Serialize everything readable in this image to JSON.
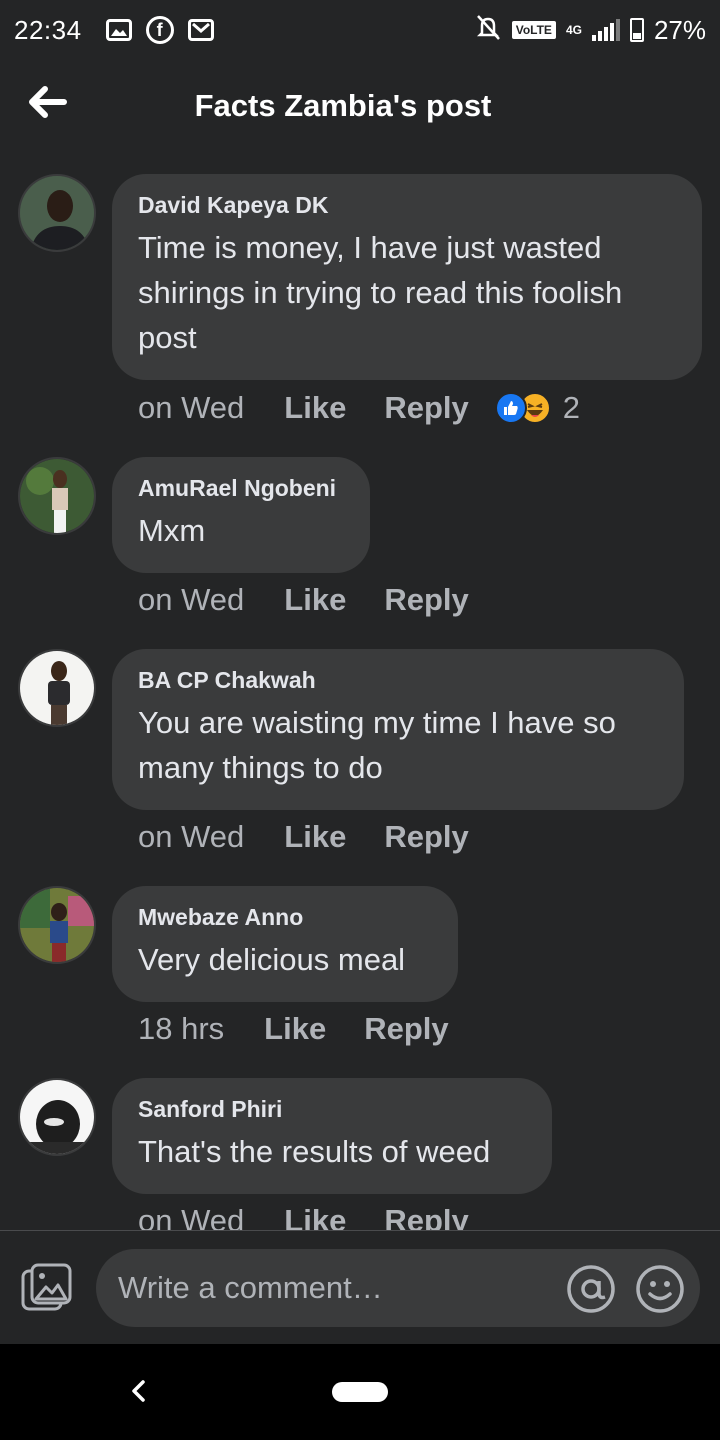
{
  "status_bar": {
    "time": "22:34",
    "volte": "VoLTE",
    "network": "4G",
    "battery": "27%",
    "icons_left": [
      "gallery-icon",
      "facebook-icon",
      "gmail-icon"
    ],
    "icons_right": [
      "mute-icon",
      "signal-icon",
      "battery-icon"
    ]
  },
  "header": {
    "title": "Facts Zambia's post"
  },
  "comments": [
    {
      "author": "David Kapeya DK",
      "lines": [
        "Time is money, I have just wasted",
        "shirings in trying to read this foolish",
        "post"
      ],
      "time": "on Wed",
      "like": "Like",
      "reply": "Reply",
      "reaction_count": "2"
    },
    {
      "author": "AmuRael Ngobeni",
      "lines": [
        "Mxm"
      ],
      "time": "on Wed",
      "like": "Like",
      "reply": "Reply"
    },
    {
      "author": "BA CP Chakwah",
      "lines": [
        "You are waisting my time I have so",
        "many things to do"
      ],
      "time": "on Wed",
      "like": "Like",
      "reply": "Reply"
    },
    {
      "author": "Mwebaze Anno",
      "lines": [
        "Very delicious meal"
      ],
      "time": "18 hrs",
      "like": "Like",
      "reply": "Reply"
    },
    {
      "author": "Sanford Phiri",
      "lines": [
        "That's the results of weed"
      ],
      "time": "on Wed",
      "like": "Like",
      "reply": "Reply"
    }
  ],
  "composer": {
    "placeholder": "Write a comment…"
  },
  "colors": {
    "background": "#242526",
    "bubble": "#3a3b3c",
    "text": "#e4e6eb",
    "muted": "#b0b3b8",
    "like_blue": "#1877f2"
  }
}
